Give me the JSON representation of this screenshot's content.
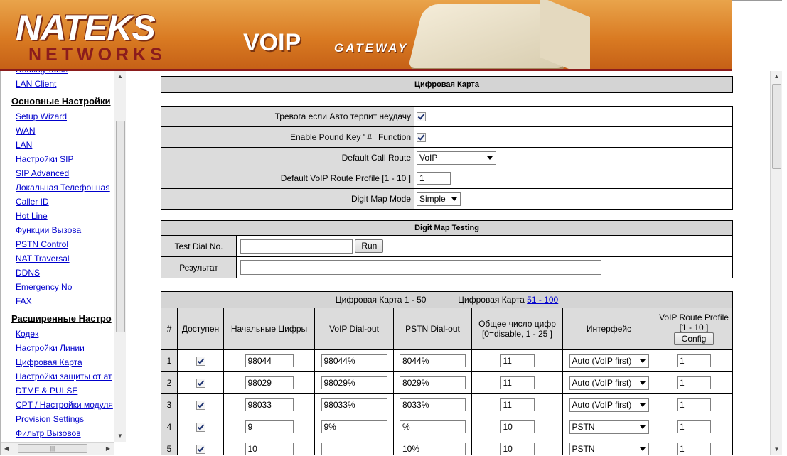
{
  "banner": {
    "brand_top": "NATEKS",
    "brand_bottom": "NETWORKS",
    "product_big": "VOIP",
    "product_small": "GATEWAY"
  },
  "sidebar": {
    "sections": [
      {
        "header": "",
        "items": [
          "Routing Table",
          "LAN Client"
        ]
      },
      {
        "header": "Основные Настройки",
        "items": [
          "Setup Wizard",
          "WAN",
          "LAN",
          "Настройки SIP",
          "SIP Advanced",
          "Локальная Телефонная",
          "Caller ID",
          "Hot Line",
          "Функции Вызова",
          "PSTN Control",
          "NAT Traversal",
          "DDNS",
          "Emergency No",
          "FAX"
        ]
      },
      {
        "header": "Расширенные Настро",
        "items": [
          "Кодек",
          "Настройки Линии",
          "Цифровая Карта",
          "Настройки защиты от ат",
          "DTMF & PULSE",
          "CPT / Настройки модуля",
          "Provision Settings",
          "Фильтр Вызовов"
        ]
      }
    ]
  },
  "page": {
    "title": "Цифровая Карта"
  },
  "settings": {
    "rows": [
      {
        "label": "Тревога если Авто терпит неудачу",
        "type": "checkbox",
        "checked": true
      },
      {
        "label": "Enable Pound Key ' # ' Function",
        "type": "checkbox",
        "checked": true
      },
      {
        "label": "Default Call Route",
        "type": "select",
        "value": "VoIP"
      },
      {
        "label": "Default VoIP Route Profile [1 - 10 ]",
        "type": "input",
        "value": "1"
      },
      {
        "label": "Digit Map Mode",
        "type": "select",
        "value": "Simple"
      }
    ]
  },
  "testing": {
    "title": "Digit Map Testing",
    "test_label": "Test Dial No.",
    "run_label": "Run",
    "result_label": "Результат",
    "test_value": "",
    "result_value": ""
  },
  "digitmap": {
    "range_current": "Цифровая Карта 1 - 50",
    "range_other_prefix": "Цифровая Карта",
    "range_other_link": "51 - 100",
    "columns": [
      "#",
      "Доступен",
      "Начальные Цифры",
      "VoIP Dial-out",
      "PSTN Dial-out",
      "Общее число цифр",
      "[0=disable, 1 - 25 ]",
      "Интерфейс",
      "VoIP Route Profile",
      "[1 - 10 ]",
      "Config"
    ],
    "rows": [
      {
        "n": "1",
        "enabled": true,
        "prefix": "98044",
        "voip": "98044%",
        "pstn": "8044%",
        "digits": "11",
        "iface": "Auto (VoIP first)",
        "profile": "1"
      },
      {
        "n": "2",
        "enabled": true,
        "prefix": "98029",
        "voip": "98029%",
        "pstn": "8029%",
        "digits": "11",
        "iface": "Auto (VoIP first)",
        "profile": "1"
      },
      {
        "n": "3",
        "enabled": true,
        "prefix": "98033",
        "voip": "98033%",
        "pstn": "8033%",
        "digits": "11",
        "iface": "Auto (VoIP first)",
        "profile": "1"
      },
      {
        "n": "4",
        "enabled": true,
        "prefix": "9",
        "voip": "9%",
        "pstn": "%",
        "digits": "10",
        "iface": "PSTN",
        "profile": "1"
      },
      {
        "n": "5",
        "enabled": true,
        "prefix": "10",
        "voip": "",
        "pstn": "10%",
        "digits": "10",
        "iface": "PSTN",
        "profile": "1"
      }
    ]
  }
}
